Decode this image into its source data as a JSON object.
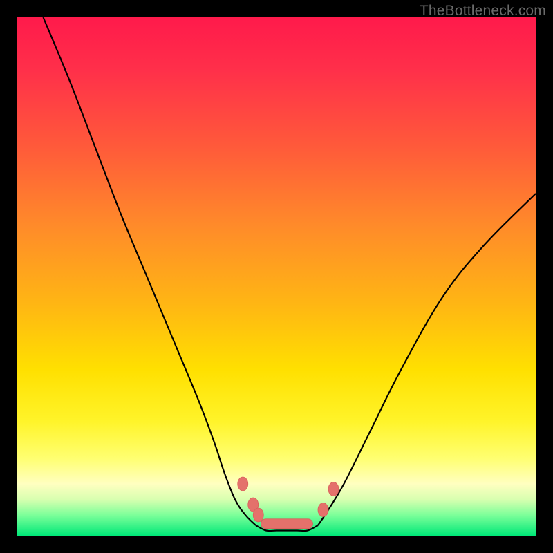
{
  "watermark": "TheBottleneck.com",
  "chart_data": {
    "type": "line",
    "title": "",
    "xlabel": "",
    "ylabel": "",
    "xlim": [
      0,
      100
    ],
    "ylim": [
      0,
      100
    ],
    "grid": false,
    "legend": false,
    "series": [
      {
        "name": "left-curve",
        "x": [
          5,
          10,
          15,
          20,
          25,
          30,
          35,
          38,
          40,
          42,
          44,
          46
        ],
        "y": [
          100,
          88,
          75,
          62,
          50,
          38,
          26,
          18,
          12,
          7,
          4,
          2
        ]
      },
      {
        "name": "trough",
        "x": [
          46,
          48,
          50,
          52,
          54,
          56,
          58
        ],
        "y": [
          2,
          1,
          1,
          1,
          1,
          1,
          2
        ]
      },
      {
        "name": "right-curve",
        "x": [
          58,
          60,
          63,
          68,
          74,
          82,
          90,
          100
        ],
        "y": [
          2,
          5,
          10,
          20,
          32,
          46,
          56,
          66
        ]
      }
    ],
    "markers": [
      {
        "x": 43.5,
        "y": 10
      },
      {
        "x": 45.5,
        "y": 6
      },
      {
        "x": 46.5,
        "y": 4
      },
      {
        "x": 59.0,
        "y": 5
      },
      {
        "x": 61.0,
        "y": 9
      }
    ],
    "trough_bar": {
      "x_start": 47,
      "x_end": 57,
      "y": 2.3
    },
    "background_gradient_stops": [
      {
        "pct": 0,
        "color": "#ff1a4b"
      },
      {
        "pct": 25,
        "color": "#ff5a3a"
      },
      {
        "pct": 55,
        "color": "#ffb514"
      },
      {
        "pct": 78,
        "color": "#fff42a"
      },
      {
        "pct": 93,
        "color": "#d8ffb0"
      },
      {
        "pct": 100,
        "color": "#00e878"
      }
    ]
  }
}
